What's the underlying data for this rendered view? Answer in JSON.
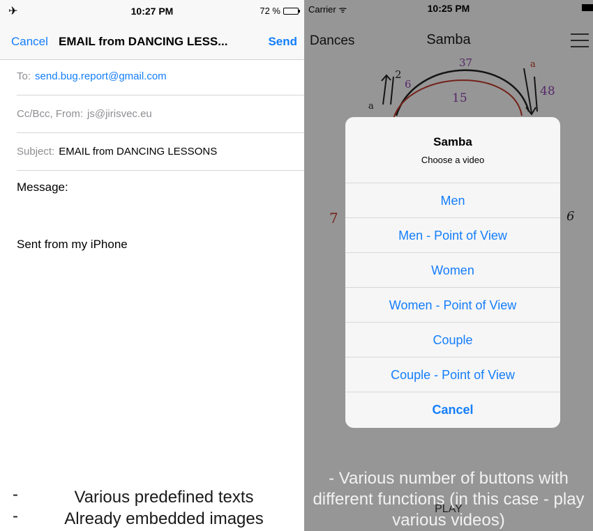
{
  "left": {
    "status": {
      "airplane_icon": "airplane-icon",
      "time": "10:27 PM",
      "battery": "72 %",
      "battery_level": 0.72
    },
    "nav": {
      "cancel": "Cancel",
      "title": "EMAIL from DANCING LESS...",
      "send": "Send"
    },
    "to": {
      "label": "To:",
      "value": "send.bug.report@gmail.com"
    },
    "cc": {
      "label": "Cc/Bcc, From:",
      "value": "js@jirisvec.eu"
    },
    "subject": {
      "label": "Subject:",
      "value": "EMAIL from DANCING LESSONS"
    },
    "message_label": "Message:",
    "signature": "Sent from my iPhone",
    "notes": [
      {
        "dash": "-",
        "text": "Various predefined texts"
      },
      {
        "dash": "-",
        "text": "Already embedded images"
      }
    ]
  },
  "right": {
    "status": {
      "carrier": "Carrier",
      "wifi_icon": "wifi-icon",
      "time": "10:25 PM"
    },
    "nav": {
      "back": "Dances",
      "title": "Samba",
      "menu_icon": "hamburger-icon"
    },
    "diagram_labels": {
      "top": "37",
      "top_right_a": "a",
      "top_right": "48",
      "mid_left": "2",
      "mid_left_b": "6",
      "center": "15",
      "left_a": "a",
      "right_num": "6",
      "left_num": "7"
    },
    "alert": {
      "title": "Samba",
      "subtitle": "Choose a video",
      "buttons": [
        "Men",
        "Men - Point of View",
        "Women",
        "Women - Point of View",
        "Couple",
        "Couple - Point of View"
      ],
      "cancel": "Cancel"
    },
    "note": "- Various number of buttons with different functions (in this case - play various videos)",
    "play": "PLAY"
  },
  "colors": {
    "ios_blue": "#147efb",
    "dim_overlay": "rgba(0,0,0,0.40)"
  }
}
